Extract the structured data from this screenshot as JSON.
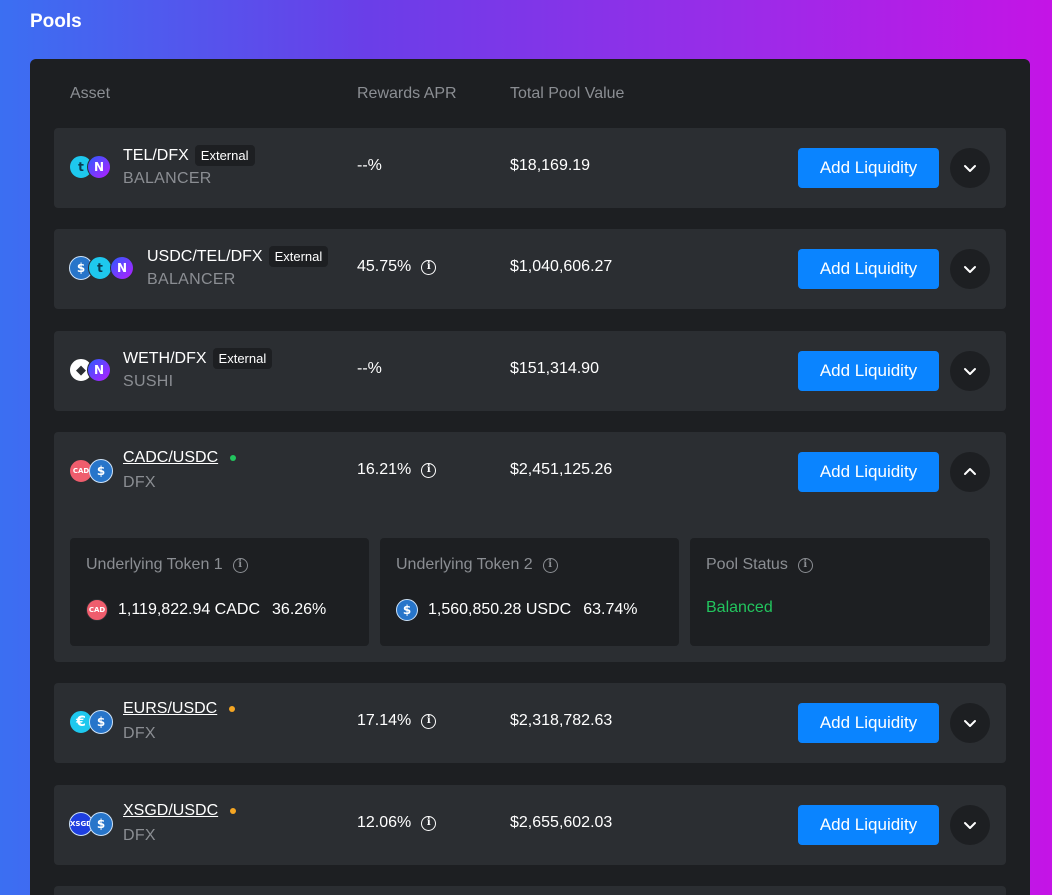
{
  "page": {
    "title": "Pools"
  },
  "table": {
    "headers": {
      "asset": "Asset",
      "apr": "Rewards APR",
      "tpv": "Total Pool Value"
    }
  },
  "pools": [
    {
      "pair": "TEL/DFX",
      "badge": "External",
      "source": "BALANCER",
      "apr": "--%",
      "tpv": "$18,169.19",
      "action": "Add Liquidity"
    },
    {
      "pair": "USDC/TEL/DFX",
      "badge": "External",
      "source": "BALANCER",
      "apr": "45.75%",
      "tpv": "$1,040,606.27",
      "action": "Add Liquidity"
    },
    {
      "pair": "WETH/DFX",
      "badge": "External",
      "source": "SUSHI",
      "apr": "--%",
      "tpv": "$151,314.90",
      "action": "Add Liquidity"
    },
    {
      "pair": "CADC/USDC",
      "status_color": "#22c55e",
      "source": "DFX",
      "apr": "16.21%",
      "tpv": "$2,451,125.26",
      "action": "Add Liquidity",
      "details": {
        "token1": {
          "label": "Underlying Token 1",
          "icon_text": "CAD",
          "amount": "1,119,822.94 CADC",
          "pct": "36.26%"
        },
        "token2": {
          "label": "Underlying Token 2",
          "icon_text": "$",
          "amount": "1,560,850.28 USDC",
          "pct": "63.74%"
        },
        "status": {
          "label": "Pool Status",
          "value": "Balanced"
        }
      }
    },
    {
      "pair": "EURS/USDC",
      "status_color": "#f5a623",
      "source": "DFX",
      "apr": "17.14%",
      "tpv": "$2,318,782.63",
      "action": "Add Liquidity"
    },
    {
      "pair": "XSGD/USDC",
      "status_color": "#f5a623",
      "source": "DFX",
      "apr": "12.06%",
      "tpv": "$2,655,602.03",
      "action": "Add Liquidity"
    }
  ],
  "icons": {
    "tel": "t",
    "dfx": "N",
    "usdc": "$",
    "weth": "◆",
    "cad": "CAD",
    "eur": "€",
    "xsgd": "XSGD"
  }
}
